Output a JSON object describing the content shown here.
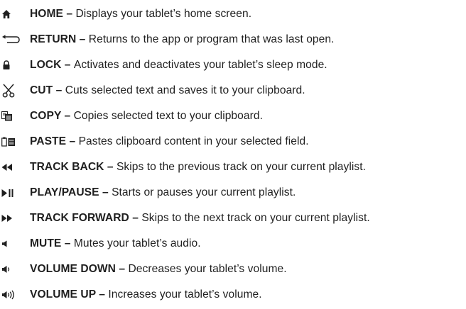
{
  "items": [
    {
      "icon": "home-icon",
      "name": "HOME",
      "separator": " – ",
      "description": "Displays your tablet’s home screen."
    },
    {
      "icon": "return-icon",
      "name": "RETURN",
      "separator": " – ",
      "description": "Returns to the app or program that was last open."
    },
    {
      "icon": "lock-icon",
      "name": "LOCK",
      "separator": " – ",
      "description": "Activates and deactivates your tablet’s sleep mode."
    },
    {
      "icon": "scissors-icon",
      "name": "CUT",
      "separator": " – ",
      "description": "Cuts selected text and saves it to your clipboard."
    },
    {
      "icon": "copy-icon",
      "name": "COPY",
      "separator": " – ",
      "description": "Copies selected text to your clipboard."
    },
    {
      "icon": "paste-icon",
      "name": "PASTE",
      "separator": " – ",
      "description": "Pastes clipboard content in your selected field."
    },
    {
      "icon": "rewind-icon",
      "name": "TRACK BACK",
      "separator": " – ",
      "description": "Skips to the previous track on your current playlist."
    },
    {
      "icon": "play-pause-icon",
      "name": "PLAY/PAUSE",
      "separator": " – ",
      "description": "Starts or pauses your current playlist."
    },
    {
      "icon": "fast-forward-icon",
      "name": "TRACK FORWARD",
      "separator": " – ",
      "description": "Skips to the next track on your current playlist."
    },
    {
      "icon": "mute-icon",
      "name": "MUTE",
      "separator": " – ",
      "description": "Mutes your tablet’s audio."
    },
    {
      "icon": "volume-down-icon",
      "name": "VOLUME DOWN",
      "separator": " – ",
      "description": "Decreases your tablet’s volume."
    },
    {
      "icon": "volume-up-icon",
      "name": "VOLUME UP",
      "separator": " – ",
      "description": "Increases your tablet’s volume."
    }
  ]
}
